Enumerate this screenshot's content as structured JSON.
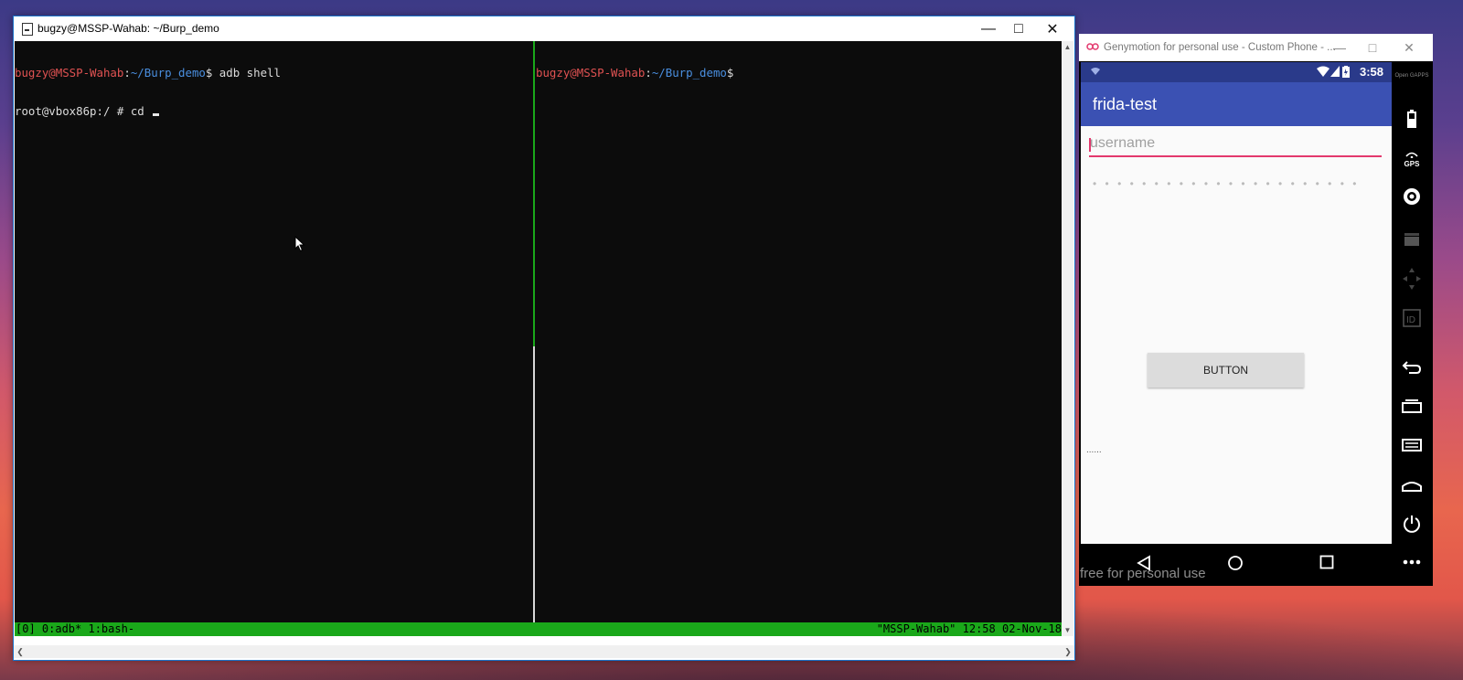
{
  "terminal": {
    "title": "bugzy@MSSP-Wahab: ~/Burp_demo",
    "left_pane": {
      "line1": {
        "user": "bugzy@MSSP-Wahab",
        "sep": ":",
        "path": "~/Burp_demo",
        "cmd": "$ adb shell"
      },
      "line2": "root@vbox86p:/ # cd "
    },
    "right_pane": {
      "line1": {
        "user": "bugzy@MSSP-Wahab",
        "sep": ":",
        "path": "~/Burp_demo",
        "cmd": "$"
      }
    },
    "status_left": "[0] 0:adb* 1:bash-",
    "status_right": "\"MSSP-Wahab\" 12:58 02-Nov-18",
    "colors": {
      "user": "#e05252",
      "path": "#4a8fe0",
      "status_bg": "#1aa81a"
    }
  },
  "genymotion": {
    "title": "Genymotion for personal use - Custom Phone - ...",
    "watermark": "free for personal use",
    "phone": {
      "time": "3:58",
      "app_title": "frida-test",
      "username_placeholder": "username",
      "password_mask": "• • • • • • • • • • • • • • • • • • • • • •",
      "button_label": "BUTTON",
      "bottom_dots": "......"
    },
    "sidebar": {
      "open_gapps": "Open GAPPS",
      "gps": "GPS",
      "icons": [
        "open-gapps-icon",
        "battery-icon",
        "gps-icon",
        "camera-icon",
        "capture-icon",
        "dpad-icon",
        "id-icon",
        "back-icon",
        "recent-apps-icon",
        "menu-icon",
        "home-icon",
        "power-icon",
        "more-icon"
      ]
    },
    "colors": {
      "status_bar": "#2a3a8a",
      "app_bar": "#3b51b3",
      "accent": "#e3386d"
    }
  }
}
